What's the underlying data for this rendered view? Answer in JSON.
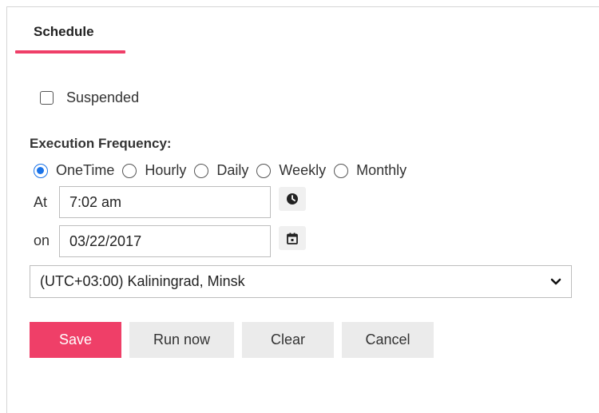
{
  "tab": {
    "label": "Schedule",
    "accent_color": "#ef3f68"
  },
  "suspended": {
    "label": "Suspended",
    "checked": false
  },
  "frequency": {
    "label": "Execution Frequency:",
    "options": [
      {
        "label": "OneTime",
        "checked": true
      },
      {
        "label": "Hourly",
        "checked": false
      },
      {
        "label": "Daily",
        "checked": false
      },
      {
        "label": "Weekly",
        "checked": false
      },
      {
        "label": "Monthly",
        "checked": false
      }
    ]
  },
  "at": {
    "label": "At",
    "value": "7:02 am",
    "icon": "clock-icon"
  },
  "on": {
    "label": "on",
    "value": "03/22/2017",
    "icon": "calendar-icon"
  },
  "timezone": {
    "value": "(UTC+03:00) Kaliningrad, Minsk",
    "icon": "chevron-down-icon"
  },
  "buttons": {
    "save": "Save",
    "run_now": "Run now",
    "clear": "Clear",
    "cancel": "Cancel"
  }
}
